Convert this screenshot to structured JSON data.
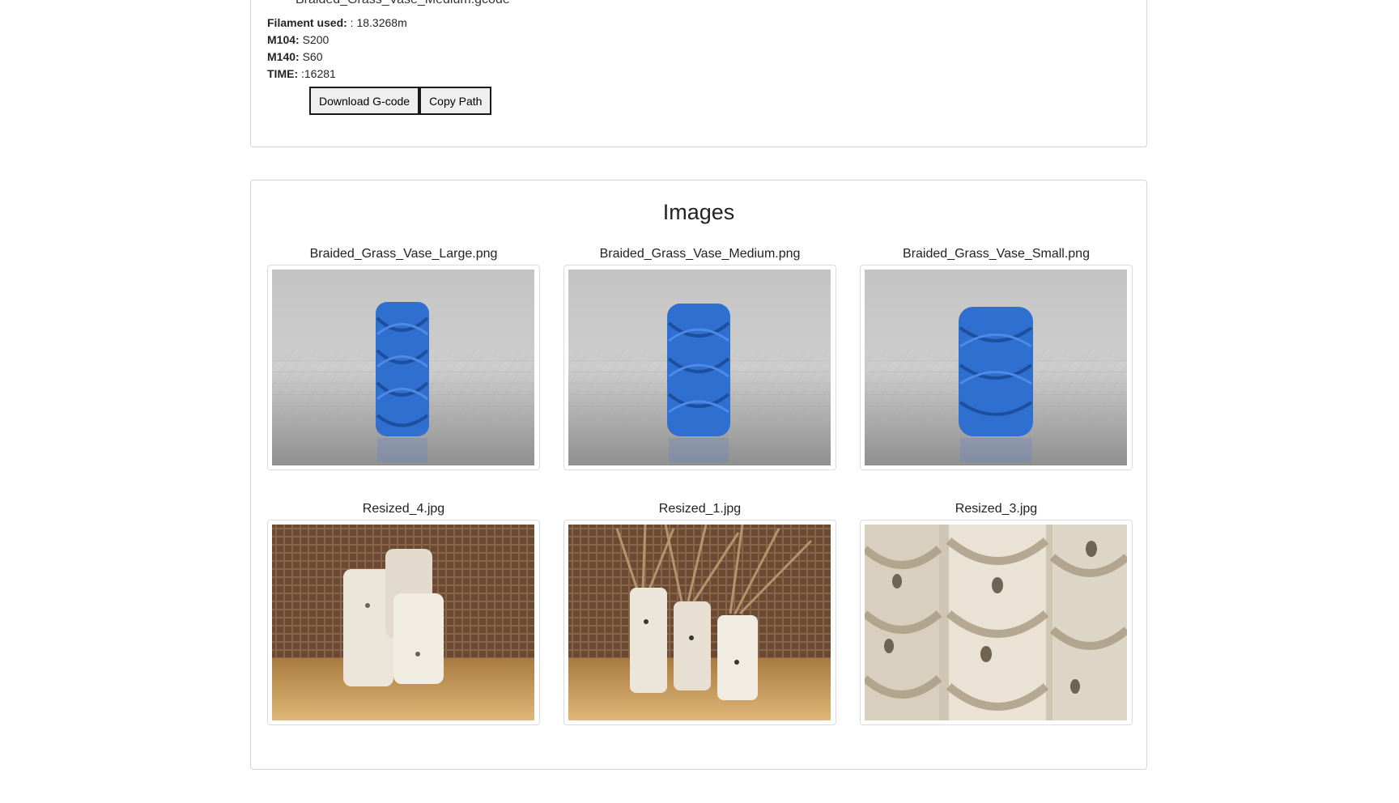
{
  "gcode": {
    "file_name": "Braided_Grass_Vase_Medium.gcode",
    "rows": [
      {
        "key": "Filament used:",
        "value": " : 18.3268m"
      },
      {
        "key": "M104:",
        "value": " S200"
      },
      {
        "key": "M140:",
        "value": " S60"
      },
      {
        "key": "TIME:",
        "value": " :16281"
      }
    ],
    "download_label": "Download G-code",
    "copy_label": "Copy Path"
  },
  "images": {
    "title": "Images",
    "items": [
      {
        "caption": "Braided_Grass_Vase_Large.png"
      },
      {
        "caption": "Braided_Grass_Vase_Medium.png"
      },
      {
        "caption": "Braided_Grass_Vase_Small.png"
      },
      {
        "caption": "Resized_4.jpg"
      },
      {
        "caption": "Resized_1.jpg"
      },
      {
        "caption": "Resized_3.jpg"
      }
    ]
  },
  "colors": {
    "vase_blue": "#2f6fd0",
    "render_bg": "#c9c9c9",
    "wicker": "#6b4a33",
    "wood_floor": "#c99a55",
    "vase_white": "#ece6da"
  }
}
